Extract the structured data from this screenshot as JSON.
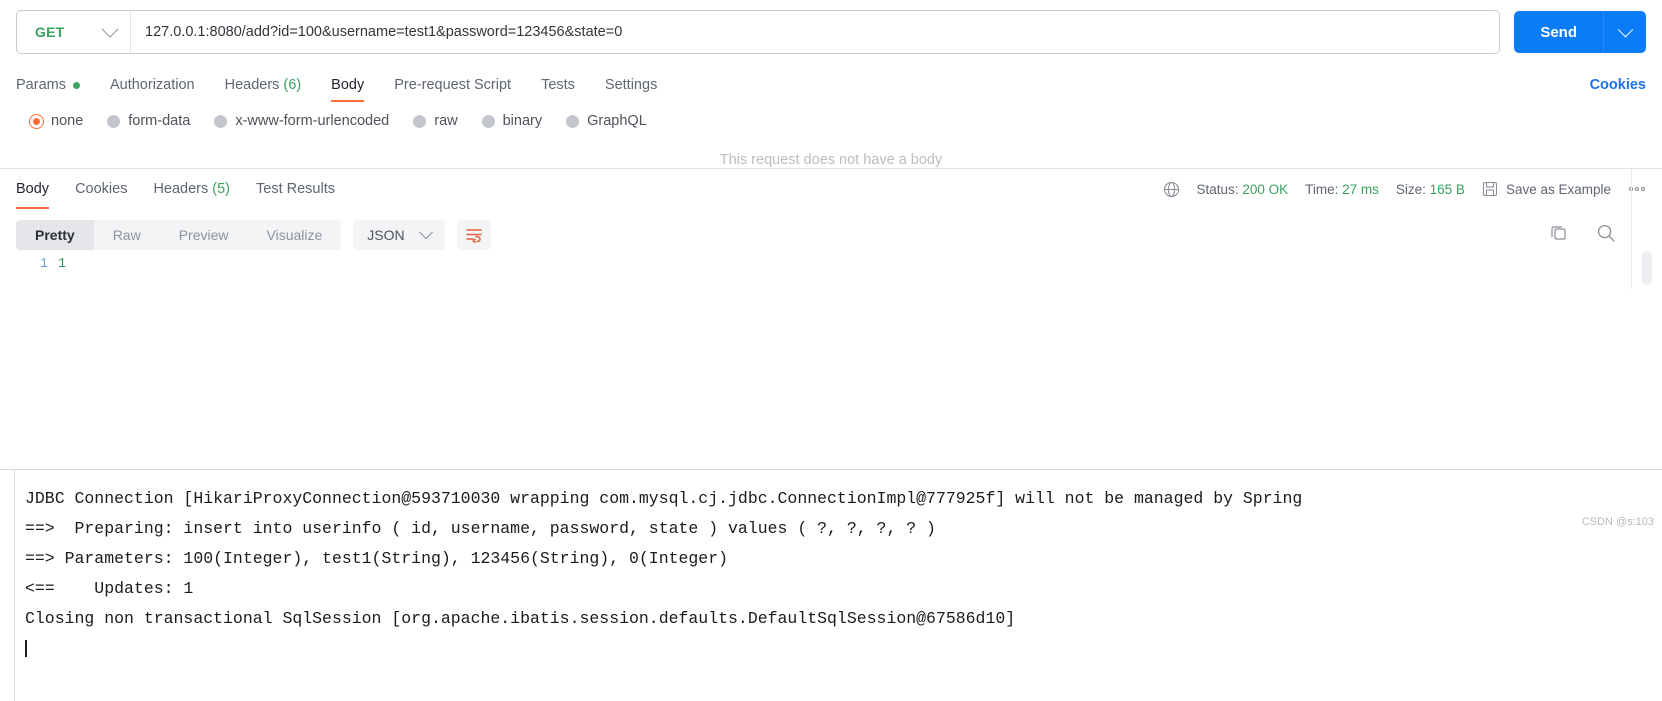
{
  "request": {
    "method": "GET",
    "url": "127.0.0.1:8080/add?id=100&username=test1&password=123456&state=0",
    "send_label": "Send",
    "send_caret_icon": "chevron-down-icon",
    "method_caret_icon": "chevron-down-icon",
    "tabs": [
      {
        "label": "Params",
        "badge": "",
        "has_dot": true,
        "active": false
      },
      {
        "label": "Authorization",
        "badge": "",
        "has_dot": false,
        "active": false
      },
      {
        "label": "Headers",
        "badge": "(6)",
        "has_dot": false,
        "active": false
      },
      {
        "label": "Body",
        "badge": "",
        "has_dot": false,
        "active": true
      },
      {
        "label": "Pre-request Script",
        "badge": "",
        "has_dot": false,
        "active": false
      },
      {
        "label": "Tests",
        "badge": "",
        "has_dot": false,
        "active": false
      },
      {
        "label": "Settings",
        "badge": "",
        "has_dot": false,
        "active": false
      }
    ],
    "cookies_link": "Cookies",
    "body_types": [
      {
        "label": "none",
        "checked": true
      },
      {
        "label": "form-data",
        "checked": false
      },
      {
        "label": "x-www-form-urlencoded",
        "checked": false
      },
      {
        "label": "raw",
        "checked": false
      },
      {
        "label": "binary",
        "checked": false
      },
      {
        "label": "GraphQL",
        "checked": false
      }
    ],
    "no_body_message": "This request does not have a body"
  },
  "response": {
    "tabs": [
      {
        "label": "Body",
        "badge": "",
        "active": true
      },
      {
        "label": "Cookies",
        "badge": "",
        "active": false
      },
      {
        "label": "Headers",
        "badge": "(5)",
        "active": false
      },
      {
        "label": "Test Results",
        "badge": "",
        "active": false
      }
    ],
    "meta": {
      "globe_icon": "globe-icon",
      "status_label": "Status:",
      "status_value": "200 OK",
      "time_label": "Time:",
      "time_value": "27 ms",
      "size_label": "Size:",
      "size_value": "165 B",
      "save_icon": "save-icon",
      "save_as_example": "Save as Example",
      "more_icon": "more-options-icon"
    },
    "viewer": {
      "modes": [
        {
          "label": "Pretty",
          "active": true
        },
        {
          "label": "Raw",
          "active": false
        },
        {
          "label": "Preview",
          "active": false
        },
        {
          "label": "Visualize",
          "active": false
        }
      ],
      "format": "JSON",
      "format_caret_icon": "chevron-down-icon",
      "wrap_icon": "wrap-lines-icon",
      "copy_icon": "copy-icon",
      "search_icon": "search-icon"
    },
    "body": {
      "line_number": "1",
      "content": "1"
    }
  },
  "console": {
    "lines": [
      "JDBC Connection [HikariProxyConnection@593710030 wrapping com.mysql.cj.jdbc.ConnectionImpl@777925f] will not be managed by Spring",
      "==>  Preparing: insert into userinfo ( id, username, password, state ) values ( ?, ?, ?, ? )",
      "==> Parameters: 100(Integer), test1(String), 123456(String), 0(Integer)",
      "<==    Updates: 1",
      "Closing non transactional SqlSession [org.apache.ibatis.session.defaults.DefaultSqlSession@67586d10]"
    ]
  },
  "watermark": "CSDN @s:103",
  "colors": {
    "accent_orange": "#ff6c37",
    "send_blue": "#0a7cf7",
    "success_green": "#3aa25f",
    "link_blue": "#1a73e8"
  }
}
